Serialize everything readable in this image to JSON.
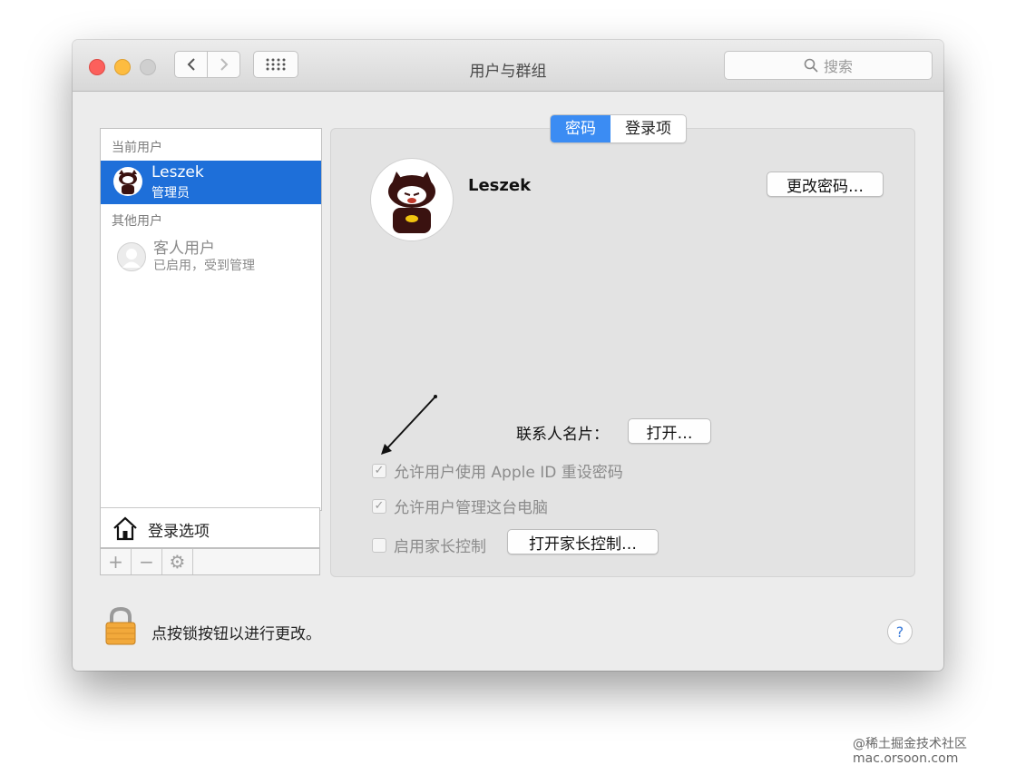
{
  "window": {
    "title": "用户与群组",
    "search_placeholder": "搜索",
    "tabs": [
      {
        "label": "密码",
        "active": true
      },
      {
        "label": "登录项",
        "active": false
      }
    ]
  },
  "sidebar": {
    "current_users_label": "当前用户",
    "current_user": {
      "name": "Leszek",
      "role": "管理员"
    },
    "other_users_label": "其他用户",
    "guest_user": {
      "name": "客人用户",
      "status": "已启用，受到管理"
    },
    "login_options_label": "登录选项",
    "list_buttons": [
      "+",
      "−",
      "⚙"
    ]
  },
  "main": {
    "profile_name": "Leszek",
    "change_password_label": "更改密码…",
    "contact_card_label": "联系人名片：",
    "open_label": "打开…",
    "checkboxes": [
      {
        "label": "允许用户使用 Apple ID 重设密码",
        "checked": true
      },
      {
        "label": "允许用户管理这台电脑",
        "checked": true
      },
      {
        "label": "启用家长控制",
        "checked": false
      }
    ],
    "parental_controls_button": "打开家长控制…"
  },
  "footer": {
    "lock_text": "点按锁按钮以进行更改。",
    "help_label": "?"
  },
  "watermark": {
    "line1": "@稀土掘金技术社区",
    "line2": "mac.orsoon.com"
  },
  "colors": {
    "accent": "#3b8cf3",
    "selection": "#1e6fd9",
    "window_bg": "#ececec"
  }
}
